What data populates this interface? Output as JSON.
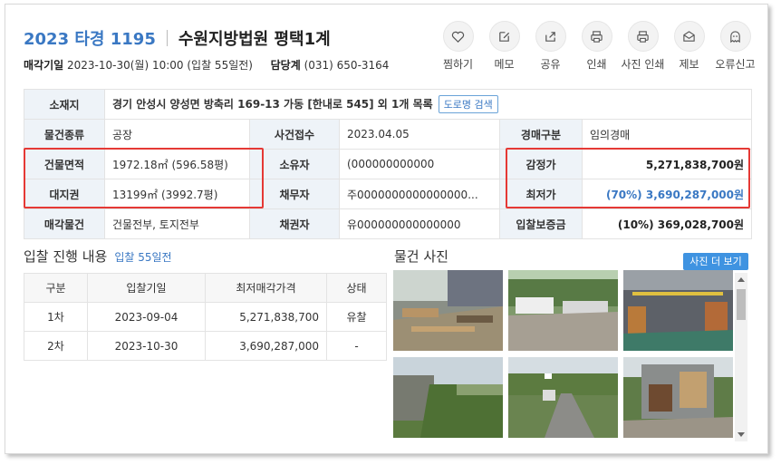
{
  "header": {
    "case_number": "2023 타경 1195",
    "court": "수원지방법원 평택1계",
    "sale_date_label": "매각기일",
    "sale_date_value": "2023-10-30(월) 10:00 (입찰 55일전)",
    "contact_label": "담당계",
    "contact_value": "(031) 650-3164"
  },
  "actions": [
    {
      "label": "찜하기",
      "icon": "heart-icon"
    },
    {
      "label": "메모",
      "icon": "edit-icon"
    },
    {
      "label": "공유",
      "icon": "share-icon"
    },
    {
      "label": "인쇄",
      "icon": "print-icon"
    },
    {
      "label": "사진 인쇄",
      "icon": "print-icon"
    },
    {
      "label": "제보",
      "icon": "mail-icon"
    },
    {
      "label": "오류신고",
      "icon": "ghost-icon"
    }
  ],
  "info": {
    "location_label": "소재지",
    "location_value": "경기 안성시 양성면 방축리 169-13 가동 [한내로 545] 외 1개 목록",
    "road_search": "도로명 검색",
    "type_label": "물건종류",
    "type_value": "공장",
    "received_label": "사건접수",
    "received_value": "2023.04.05",
    "auction_type_label": "경매구분",
    "auction_type_value": "임의경매",
    "building_area_label": "건물면적",
    "building_area_value": "1972.18㎡ (596.58평)",
    "owner_label": "소유자",
    "owner_value": "(000000000000",
    "appraisal_label": "감정가",
    "appraisal_value": "5,271,838,700원",
    "land_right_label": "대지권",
    "land_right_value": "13199㎡ (3992.7평)",
    "debtor_label": "채무자",
    "debtor_value": "주0000000000000000...",
    "min_price_label": "최저가",
    "min_price_value": "(70%) 3,690,287,000원",
    "sale_item_label": "매각물건",
    "sale_item_value": "건물전부, 토지전부",
    "creditor_label": "채권자",
    "creditor_value": "유000000000000000",
    "deposit_label": "입찰보증금",
    "deposit_value": "(10%) 369,028,700원"
  },
  "bids": {
    "title": "입찰 진행 내용",
    "subtitle": "입찰 55일전",
    "headers": [
      "구분",
      "입찰기일",
      "최저매각가격",
      "상태"
    ],
    "rows": [
      [
        "1차",
        "2023-09-04",
        "5,271,838,700",
        "유찰"
      ],
      [
        "2차",
        "2023-10-30",
        "3,690,287,000",
        "-"
      ]
    ]
  },
  "photos": {
    "title": "물건 사진",
    "more_button": "사진 더 보기"
  },
  "colors": {
    "accent": "#3a78c3",
    "highlight": "#e53935",
    "header_cell": "#eef3f8",
    "button": "#3f93e1"
  }
}
